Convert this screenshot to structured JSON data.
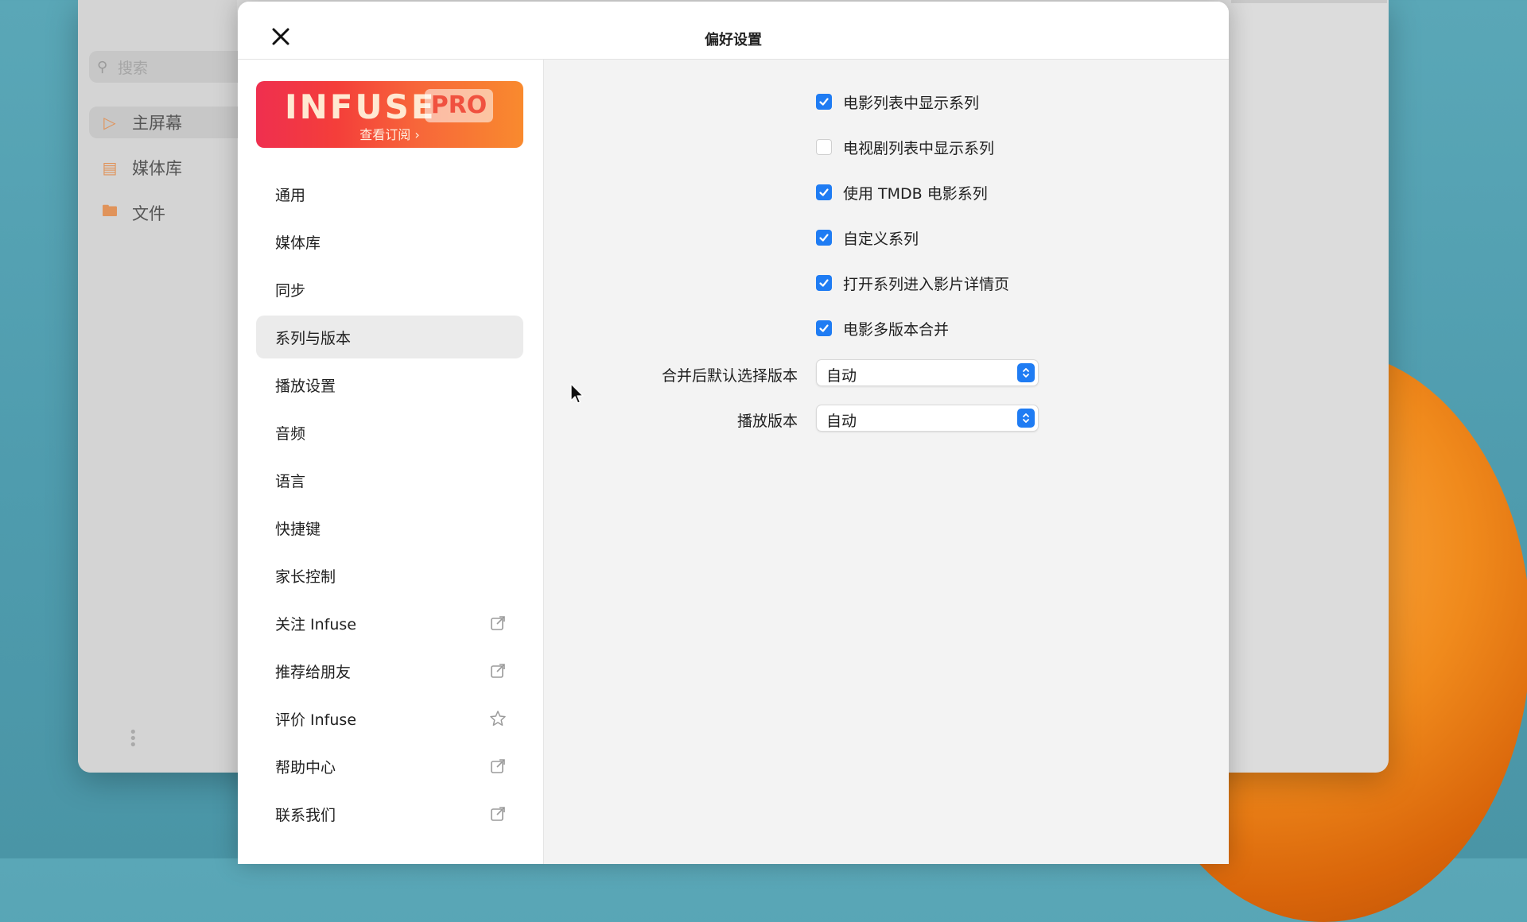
{
  "background_app": {
    "search": {
      "placeholder": "搜索"
    },
    "nav": [
      {
        "label": "主屏幕",
        "icon": "play-icon",
        "active": true
      },
      {
        "label": "媒体库",
        "icon": "library-icon",
        "active": false
      },
      {
        "label": "文件",
        "icon": "folder-icon",
        "active": false
      }
    ]
  },
  "modal": {
    "title": "偏好设置",
    "promo": {
      "brand": "INFUSE",
      "badge": "PRO",
      "subtitle": "查看订阅 ›"
    },
    "sidebar": {
      "items": [
        {
          "label": "通用",
          "trailing_icon": null
        },
        {
          "label": "媒体库",
          "trailing_icon": null
        },
        {
          "label": "同步",
          "trailing_icon": null
        },
        {
          "label": "系列与版本",
          "trailing_icon": null,
          "active": true
        },
        {
          "label": "播放设置",
          "trailing_icon": null
        },
        {
          "label": "音频",
          "trailing_icon": null
        },
        {
          "label": "语言",
          "trailing_icon": null
        },
        {
          "label": "快捷键",
          "trailing_icon": null
        },
        {
          "label": "家长控制",
          "trailing_icon": null
        },
        {
          "label": "关注 Infuse",
          "trailing_icon": "external-link-icon"
        },
        {
          "label": "推荐给朋友",
          "trailing_icon": "external-link-icon"
        },
        {
          "label": "评价 Infuse",
          "trailing_icon": "star-icon"
        },
        {
          "label": "帮助中心",
          "trailing_icon": "external-link-icon"
        },
        {
          "label": "联系我们",
          "trailing_icon": "external-link-icon"
        }
      ]
    },
    "settings": {
      "checkboxes": [
        {
          "label": "电影列表中显示系列",
          "checked": true
        },
        {
          "label": "电视剧列表中显示系列",
          "checked": false
        },
        {
          "label": "使用 TMDB 电影系列",
          "checked": true
        },
        {
          "label": "自定义系列",
          "checked": true
        },
        {
          "label": "打开系列进入影片详情页",
          "checked": true
        },
        {
          "label": "电影多版本合并",
          "checked": true
        }
      ],
      "selects": [
        {
          "label": "合并后默认选择版本",
          "value": "自动"
        },
        {
          "label": "播放版本",
          "value": "自动"
        }
      ]
    }
  },
  "colors": {
    "accent": "#1f7cf3",
    "promo_start": "#ef2f4f",
    "promo_end": "#f98a2e"
  }
}
